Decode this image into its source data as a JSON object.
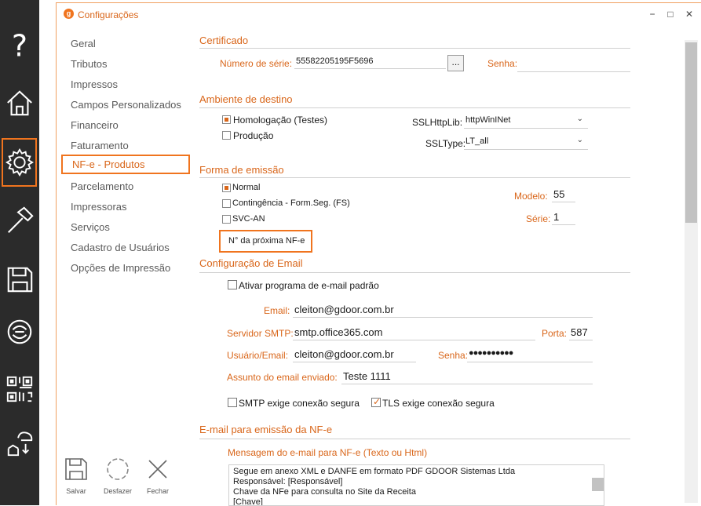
{
  "window": {
    "title": "Configurações",
    "logo_letter": "g",
    "minimize": "−",
    "maximize": "□",
    "close": "✕"
  },
  "rail": [
    {
      "icon": "help-icon"
    },
    {
      "icon": "home-icon"
    },
    {
      "icon": "gear-icon",
      "active": true
    },
    {
      "icon": "hammer-icon"
    },
    {
      "icon": "save-icon"
    },
    {
      "icon": "sync-icon"
    },
    {
      "icon": "qrcode-icon"
    },
    {
      "icon": "cloud-export-icon"
    }
  ],
  "menu": {
    "items": [
      "Geral",
      "Tributos",
      "Impressos",
      "Campos Personalizados",
      "Financeiro",
      "Faturamento",
      "NF-e - Produtos",
      "Parcelamento",
      "Impressoras",
      "Serviços",
      "Cadastro de Usuários",
      "Opções de Impressão"
    ],
    "active_index": 6
  },
  "tools": {
    "save": "Salvar",
    "undo": "Desfazer",
    "close": "Fechar"
  },
  "certificado": {
    "title": "Certificado",
    "serial_label": "Número de série:",
    "serial_value": "55582205195F5696",
    "browse": "...",
    "password_label": "Senha:",
    "password_value": ""
  },
  "ambiente": {
    "title": "Ambiente de destino",
    "options": [
      "Homologação (Testes)",
      "Produção"
    ],
    "selected": 0,
    "ssl_lib_label": "SSLHttpLib:",
    "ssl_lib_value": "httpWinINet",
    "ssl_type_label": "SSLType:",
    "ssl_type_value": "LT_all"
  },
  "emissao": {
    "title": "Forma de emissão",
    "options": [
      "Normal",
      "Contingência - Form.Seg. (FS)",
      "SVC-AN"
    ],
    "selected": 0,
    "modelo_label": "Modelo:",
    "modelo_value": "55",
    "serie_label": "Série:",
    "serie_value": "1",
    "next_nfe_button": "N° da próxima NF-e"
  },
  "email": {
    "title": "Configuração de Email",
    "default_program_label": "Ativar programa de e-mail padrão",
    "default_program_checked": false,
    "email_label": "Email:",
    "email_value": "cleiton@gdoor.com.br",
    "smtp_label": "Servidor SMTP:",
    "smtp_value": "smtp.office365.com",
    "port_label": "Porta:",
    "port_value": "587",
    "user_label": "Usuário/Email:",
    "user_value": "cleiton@gdoor.com.br",
    "password_label": "Senha:",
    "password_value": "●●●●●●●●●●",
    "subject_label": "Assunto do email enviado:",
    "subject_value": "Teste 1111",
    "ssl_label": "SMTP exige conexão segura",
    "ssl_checked": false,
    "tls_label": "TLS exige conexão segura",
    "tls_checked": true
  },
  "nfe_email": {
    "title": "E-mail para emissão da NF-e",
    "message_label": "Mensagem do e-mail para NF-e (Texto ou Html)",
    "message_lines": [
      "Segue em anexo XML e DANFE em formato PDF GDOOR Sistemas Ltda",
      "Responsável: [Responsável]",
      "Chave da NFe para consulta no Site da Receita",
      "[Chave]"
    ]
  },
  "colors": {
    "accent": "#f0741e",
    "accent_text": "#d9661a",
    "rail": "#2b2b2b"
  }
}
